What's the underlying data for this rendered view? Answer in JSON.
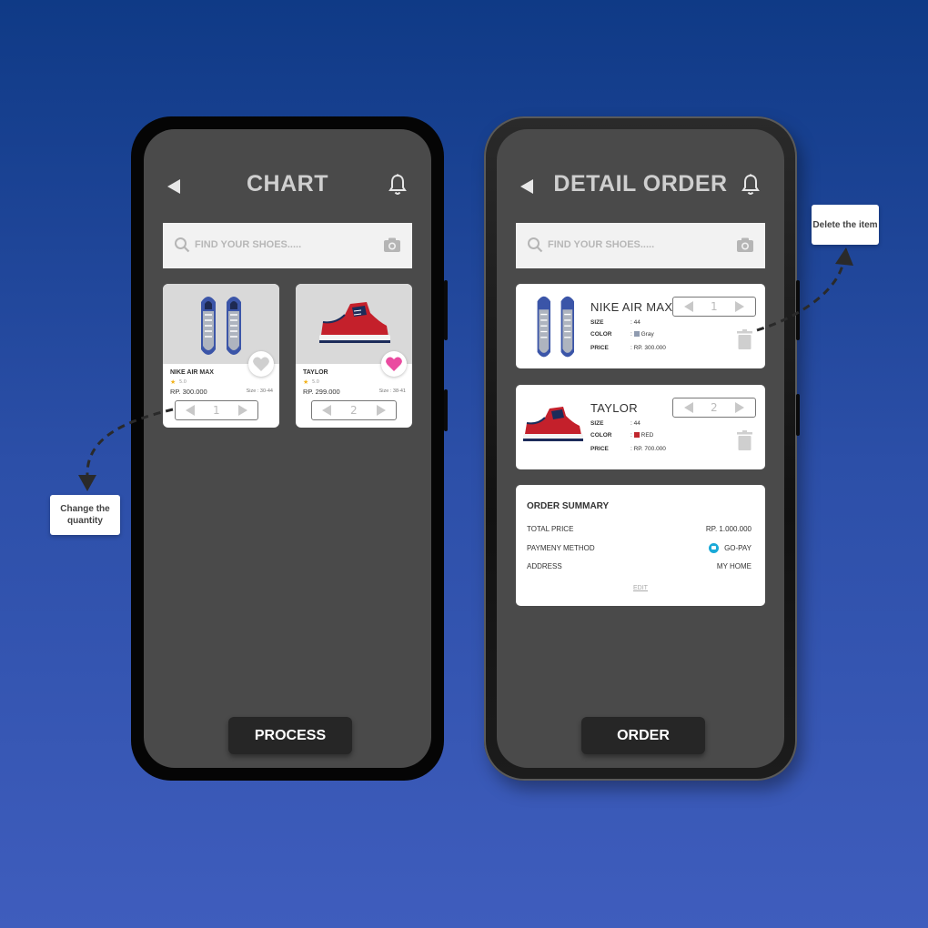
{
  "colors": {
    "accent_pink": "#ea4ba0",
    "gopay_blue": "#19a9d8",
    "swatch_gray": "#8f9bb0",
    "swatch_red": "#c0262d"
  },
  "chart_screen": {
    "title": "CHART",
    "search_placeholder": "FIND YOUR SHOES.....",
    "products": [
      {
        "name": "NIKE AIR MAX",
        "rating": "5.0",
        "price": "RP. 300.000",
        "size": "Size : 30-44",
        "quantity": "1",
        "favorite": false
      },
      {
        "name": "TAYLOR",
        "rating": "5.0",
        "price": "RP. 299.000",
        "size": "Size : 38-41",
        "quantity": "2",
        "favorite": true
      }
    ],
    "button_label": "PROCESS"
  },
  "detail_screen": {
    "title": "DETAIL ORDER",
    "search_placeholder": "FIND YOUR SHOES.....",
    "items": [
      {
        "name": "NIKE AIR MAX",
        "size_label": "SIZE",
        "size": ": 44",
        "color_label": "COLOR",
        "color": "Gray",
        "price_label": "PRICE",
        "price": ": RP. 300.000",
        "quantity": "1"
      },
      {
        "name": "TAYLOR",
        "size_label": "SIZE",
        "size": ": 44",
        "color_label": "COLOR",
        "color": "RED",
        "price_label": "PRICE",
        "price": ": RP. 700.000",
        "quantity": "2"
      }
    ],
    "summary": {
      "title": "ORDER SUMMARY",
      "total_label": "TOTAL PRICE",
      "total_value": "RP. 1.000.000",
      "payment_label": "PAYMENY METHOD",
      "payment_value": "GO-PAY",
      "address_label": "ADDRESS",
      "address_value": "MY HOME",
      "edit_label": "EDIT"
    },
    "button_label": "ORDER"
  },
  "callouts": {
    "quantity": "Change the quantity",
    "delete": "Delete the item"
  }
}
